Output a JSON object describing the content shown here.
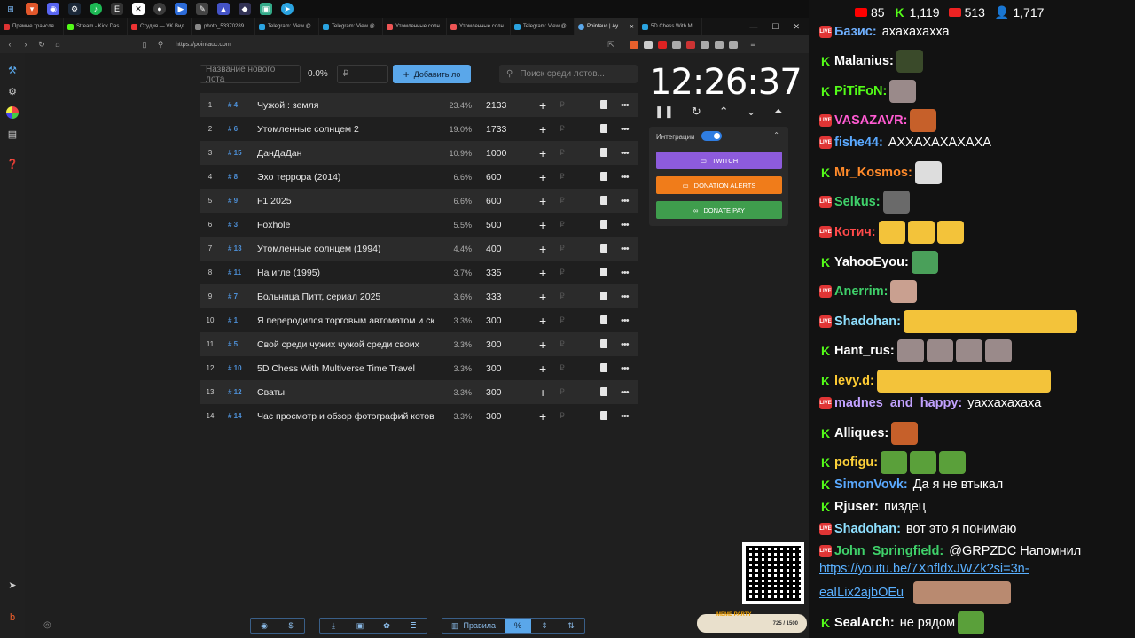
{
  "browser": {
    "url": "https://pointauc.com",
    "tabs": [
      "Прямые трансля...",
      "Stream - Kick Das...",
      "Студия — VK Вид...",
      "photo_53370289...",
      "Telegram: View @...",
      "Telegram: View @...",
      "Утомленные солн...",
      "Утомленные солн...",
      "Telegram: View @...",
      "Pointauc | Ау...",
      "5D Chess With M..."
    ],
    "active_tab": 9
  },
  "auction": {
    "new_lot_placeholder": "Название нового лота",
    "percent": "0.0%",
    "currency_placeholder": "₽",
    "add_button": "Добавить ло",
    "search_placeholder": "Поиск среди лотов...",
    "lots": [
      {
        "n": "1",
        "id": "# 4",
        "name": "Чужой : земля",
        "pct": "23.4%",
        "amount": "2133"
      },
      {
        "n": "2",
        "id": "# 6",
        "name": "Утомленные солнцем 2",
        "pct": "19.0%",
        "amount": "1733"
      },
      {
        "n": "3",
        "id": "# 15",
        "name": "ДанДаДан",
        "pct": "10.9%",
        "amount": "1000"
      },
      {
        "n": "4",
        "id": "# 8",
        "name": "Эхо террора (2014)",
        "pct": "6.6%",
        "amount": "600"
      },
      {
        "n": "5",
        "id": "# 9",
        "name": "F1 2025",
        "pct": "6.6%",
        "amount": "600"
      },
      {
        "n": "6",
        "id": "# 3",
        "name": "Foxhole",
        "pct": "5.5%",
        "amount": "500"
      },
      {
        "n": "7",
        "id": "# 13",
        "name": "Утомленные солнцем (1994)",
        "pct": "4.4%",
        "amount": "400"
      },
      {
        "n": "8",
        "id": "# 11",
        "name": "На игле (1995)",
        "pct": "3.7%",
        "amount": "335"
      },
      {
        "n": "9",
        "id": "# 7",
        "name": "Больница Питт, сериал 2025",
        "pct": "3.6%",
        "amount": "333"
      },
      {
        "n": "10",
        "id": "# 1",
        "name": "Я переродился торговым автоматом и ск",
        "pct": "3.3%",
        "amount": "300"
      },
      {
        "n": "11",
        "id": "# 5",
        "name": "Свой среди чужих чужой среди своих",
        "pct": "3.3%",
        "amount": "300"
      },
      {
        "n": "12",
        "id": "# 10",
        "name": "5D Chess With Multiverse Time Travel",
        "pct": "3.3%",
        "amount": "300"
      },
      {
        "n": "13",
        "id": "# 12",
        "name": "Сваты",
        "pct": "3.3%",
        "amount": "300"
      },
      {
        "n": "14",
        "id": "# 14",
        "name": "Час просмотр и обзор фотографий котов",
        "pct": "3.3%",
        "amount": "300"
      }
    ],
    "row_plus": "+",
    "row_rub": "₽",
    "row_more": "•••"
  },
  "timer": {
    "value": "12:26:37"
  },
  "integrations": {
    "label": "Интеграции",
    "enabled": true,
    "twitch": "TWITCH",
    "donation_alerts": "DONATION ALERTS",
    "donate_pay": "DONATE PAY",
    "colors": {
      "twitch": "#8d5bdc",
      "donation_alerts": "#f07c1a",
      "donate_pay": "#3f9d4d"
    }
  },
  "meme_party": {
    "label": "MEME PARTY",
    "progress": "725 / 1500"
  },
  "bottom_bar": {
    "rules": "Правила",
    "percent": "%"
  },
  "chat": {
    "viewers": {
      "youtube": "85",
      "kick": "1,119",
      "vk": "513",
      "total": "1,717"
    },
    "messages": [
      {
        "platform": "vk",
        "user": "Базис:",
        "user_color": "#6fb0ff",
        "text": "ахахахахха",
        "emotes": []
      },
      {
        "platform": "kick",
        "user": "Malanius:",
        "user_color": "#ffffff",
        "text": "",
        "emotes": [
          "frog"
        ]
      },
      {
        "platform": "kick",
        "user": "PiTiFoN:",
        "user_color": "#53fc18",
        "text": "",
        "emotes": [
          "cat"
        ]
      },
      {
        "platform": "vk",
        "user": "VASAZAVR:",
        "user_color": "#ff5bd2",
        "text": "",
        "emotes": [
          "face"
        ]
      },
      {
        "platform": "vk",
        "user": "fishe44:",
        "user_color": "#5aa9ff",
        "text": "АХХАХАХАХАХА",
        "emotes": []
      },
      {
        "platform": "kick",
        "user": "Mr_Kosmos:",
        "user_color": "#ff8a2a",
        "text": "",
        "emotes": [
          "troll"
        ]
      },
      {
        "platform": "vk",
        "user": "Selkus:",
        "user_color": "#3fd16a",
        "text": "",
        "emotes": [
          "man"
        ]
      },
      {
        "platform": "vk",
        "user": "Котич:",
        "user_color": "#ff4a4a",
        "text": "",
        "emotes": [
          "laugh",
          "laugh",
          "laugh"
        ]
      },
      {
        "platform": "kick",
        "user": "YahooEyou:",
        "user_color": "#ffffff",
        "text": "",
        "emotes": [
          "pc"
        ]
      },
      {
        "platform": "vk",
        "user": "Anerrim:",
        "user_color": "#3fd16a",
        "text": "",
        "emotes": [
          "dog"
        ]
      },
      {
        "platform": "vk",
        "user": "Shadohan:",
        "user_color": "#8fe0ff",
        "text": "",
        "emotes": [
          "laughwide"
        ]
      },
      {
        "platform": "kick",
        "user": "Hant_rus:",
        "user_color": "#ffffff",
        "text": "",
        "emotes": [
          "cat",
          "cat",
          "cat",
          "cat"
        ]
      },
      {
        "platform": "kick",
        "user": "levy.d:",
        "user_color": "#ffcc33",
        "text": "",
        "emotes": [
          "laughwide"
        ]
      },
      {
        "platform": "vk",
        "user": "madnes_and_happy:",
        "user_color": "#c2a2ff",
        "text": "уаххахахаха",
        "emotes": []
      },
      {
        "platform": "kick",
        "user": "Alliques:",
        "user_color": "#ffffff",
        "text": "",
        "emotes": [
          "face"
        ]
      },
      {
        "platform": "kick",
        "user": "pofigu:",
        "user_color": "#ffd23a",
        "text": "",
        "emotes": [
          "pepe",
          "pepe",
          "pepe"
        ]
      },
      {
        "platform": "kick",
        "user": "SimonVovk:",
        "user_color": "#5aa9ff",
        "text": "Да я не втыкал",
        "emotes": []
      },
      {
        "platform": "kick",
        "user": "Rjuser:",
        "user_color": "#ffffff",
        "text": "пиздец",
        "emotes": []
      },
      {
        "platform": "vk",
        "user": "Shadohan:",
        "user_color": "#8fe0ff",
        "text": "вот это я понимаю",
        "emotes": []
      },
      {
        "platform": "vk",
        "user": "John_Springfield:",
        "user_color": "#3fd16a",
        "text": "@GRPZDC Напомнил",
        "emotes": []
      },
      {
        "platform": "kick",
        "user": "SealArch:",
        "user_color": "#ffffff",
        "text": "не рядом",
        "emotes": [
          "pepe"
        ]
      }
    ],
    "link_line1": "https://youtu.be/7XnfldxJWZk?si=3n-",
    "link_line2": "eaILix2ajbOEu"
  }
}
